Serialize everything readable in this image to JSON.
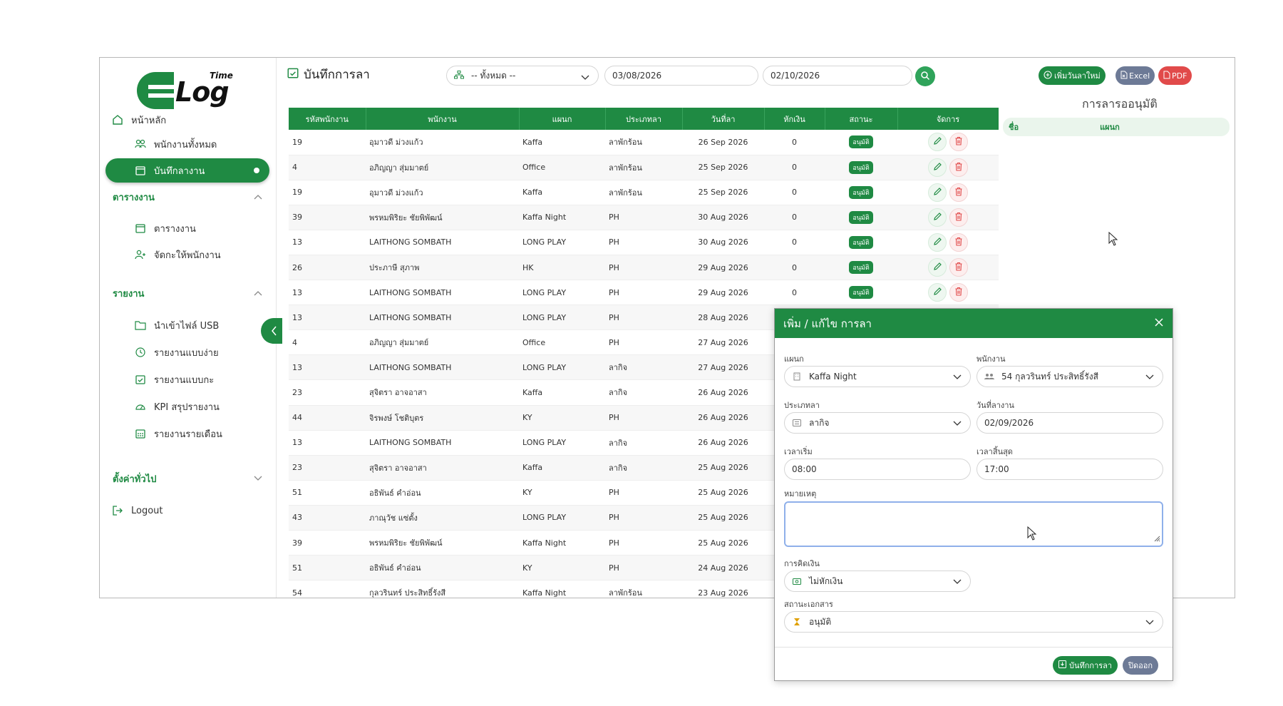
{
  "colors": {
    "primary": "#1f8a43",
    "danger": "#e14a4a",
    "excel": "#6d7a96",
    "pdf": "#e14a4a",
    "close_btn": "#6d7a96"
  },
  "logo": {
    "word": "Log",
    "small": "Time"
  },
  "sidebar": {
    "home": "หน้าหลัก",
    "all_employees": "พนักงานทั้งหมด",
    "leave_record": "บันทึกลางาน",
    "section_schedule": "ตารางงาน",
    "schedule": "ตารางงาน",
    "assign": "จัดกะให้พนักงาน",
    "section_reports": "รายงาน",
    "import_usb": "นำเข้าไฟล์ USB",
    "report_simple": "รายงานแบบง่าย",
    "report_shift": "รายงานแบบกะ",
    "kpi": "KPI สรุปรายงาน",
    "monthly": "รายงานรายเดือน",
    "section_settings": "ตั้งค่าทั่วไป",
    "logout": "Logout"
  },
  "header": {
    "title": "บันทึกการลา",
    "department_filter": "-- ทั้งหมด --",
    "date_from": "03/08/2026",
    "date_to": "02/10/2026",
    "add_button": "เพิ่มวันลาใหม่",
    "excel_button": "Excel",
    "pdf_button": "PDF"
  },
  "table": {
    "columns": [
      "รหัสพนักงาน",
      "พนักงาน",
      "แผนก",
      "ประเภทลา",
      "วันที่ลา",
      "หักเงิน",
      "สถานะ",
      "จัดการ"
    ],
    "rows": [
      {
        "id": "19",
        "name": "อุมาวดี ม่วงแก้ว",
        "dept": "Kaffa",
        "type": "ลาพักร้อน",
        "date": "26 Sep 2026",
        "deduct": "0",
        "status": "อนุมัติ"
      },
      {
        "id": "4",
        "name": "อภิญญา สุ่มมาตย์",
        "dept": "Office",
        "type": "ลาพักร้อน",
        "date": "25 Sep 2026",
        "deduct": "0",
        "status": "อนุมัติ"
      },
      {
        "id": "19",
        "name": "อุมาวดี ม่วงแก้ว",
        "dept": "Kaffa",
        "type": "ลาพักร้อน",
        "date": "25 Sep 2026",
        "deduct": "0",
        "status": "อนุมัติ"
      },
      {
        "id": "39",
        "name": "พรหมพิริยะ ชัยพิพัฒน์",
        "dept": "Kaffa Night",
        "type": "PH",
        "date": "30 Aug 2026",
        "deduct": "0",
        "status": "อนุมัติ"
      },
      {
        "id": "13",
        "name": "LAITHONG SOMBATH",
        "dept": "LONG PLAY",
        "type": "PH",
        "date": "30 Aug 2026",
        "deduct": "0",
        "status": "อนุมัติ"
      },
      {
        "id": "26",
        "name": "ประภาษี สุภาพ",
        "dept": "HK",
        "type": "PH",
        "date": "29 Aug 2026",
        "deduct": "0",
        "status": "อนุมัติ"
      },
      {
        "id": "13",
        "name": "LAITHONG SOMBATH",
        "dept": "LONG PLAY",
        "type": "PH",
        "date": "29 Aug 2026",
        "deduct": "0",
        "status": "อนุมัติ"
      },
      {
        "id": "13",
        "name": "LAITHONG SOMBATH",
        "dept": "LONG PLAY",
        "type": "PH",
        "date": "28 Aug 2026",
        "deduct": "",
        "status": ""
      },
      {
        "id": "4",
        "name": "อภิญญา สุ่มมาตย์",
        "dept": "Office",
        "type": "PH",
        "date": "27 Aug 2026",
        "deduct": "",
        "status": ""
      },
      {
        "id": "13",
        "name": "LAITHONG SOMBATH",
        "dept": "LONG PLAY",
        "type": "ลากิจ",
        "date": "27 Aug 2026",
        "deduct": "",
        "status": ""
      },
      {
        "id": "23",
        "name": "สุจิตรา อาจอาสา",
        "dept": "Kaffa",
        "type": "ลากิจ",
        "date": "26 Aug 2026",
        "deduct": "",
        "status": ""
      },
      {
        "id": "44",
        "name": "จิรพงษ์ โชติบุตร",
        "dept": "KY",
        "type": "PH",
        "date": "26 Aug 2026",
        "deduct": "",
        "status": ""
      },
      {
        "id": "13",
        "name": "LAITHONG SOMBATH",
        "dept": "LONG PLAY",
        "type": "ลากิจ",
        "date": "26 Aug 2026",
        "deduct": "",
        "status": ""
      },
      {
        "id": "23",
        "name": "สุจิตรา อาจอาสา",
        "dept": "Kaffa",
        "type": "ลากิจ",
        "date": "25 Aug 2026",
        "deduct": "",
        "status": ""
      },
      {
        "id": "51",
        "name": "อธิพันธ์ คำอ่อน",
        "dept": "KY",
        "type": "PH",
        "date": "25 Aug 2026",
        "deduct": "",
        "status": ""
      },
      {
        "id": "43",
        "name": "ภาณุวัช แซ่ตั้ง",
        "dept": "LONG PLAY",
        "type": "PH",
        "date": "25 Aug 2026",
        "deduct": "",
        "status": ""
      },
      {
        "id": "39",
        "name": "พรหมพิริยะ ชัยพิพัฒน์",
        "dept": "Kaffa Night",
        "type": "PH",
        "date": "25 Aug 2026",
        "deduct": "",
        "status": ""
      },
      {
        "id": "51",
        "name": "อธิพันธ์ คำอ่อน",
        "dept": "KY",
        "type": "PH",
        "date": "24 Aug 2026",
        "deduct": "",
        "status": ""
      },
      {
        "id": "54",
        "name": "กุลวรินทร์ ประสิทธิ์รังสี",
        "dept": "Kaffa Night",
        "type": "ลาพักร้อน",
        "date": "23 Aug 2026",
        "deduct": "",
        "status": ""
      }
    ]
  },
  "approval": {
    "title": "การลารออนุมัติ",
    "col_name": "ชื่อ",
    "col_dept": "แผนก"
  },
  "modal": {
    "title": "เพิ่ม / แก้ไข การลา",
    "dept_label": "แผนก",
    "dept_value": "Kaffa Night",
    "emp_label": "พนักงาน",
    "emp_value": "54 กุลวรินทร์ ประสิทธิ์รังสี",
    "type_label": "ประเภทลา",
    "type_value": "ลากิจ",
    "date_label": "วันที่ลางาน",
    "date_value": "02/09/2026",
    "start_label": "เวลาเริ่ม",
    "start_value": "08:00",
    "end_label": "เวลาสิ้นสุด",
    "end_value": "17:00",
    "note_label": "หมายเหตุ",
    "pay_label": "การคิดเงิน",
    "pay_value": "ไม่หักเงิน",
    "doc_label": "สถานะเอกสาร",
    "doc_value": "อนุมัติ",
    "save_button": "บันทึกการลา",
    "close_button": "ปิดออก"
  }
}
